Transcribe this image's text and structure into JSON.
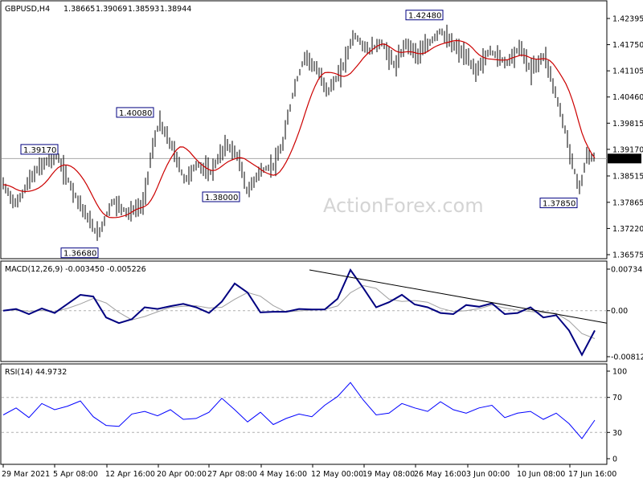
{
  "chart_data": [
    {
      "type": "candlestick",
      "panel": "price",
      "header": {
        "symbol": "GBPUSD,H4",
        "open": "1.38665",
        "high": "1.39069",
        "low": "1.38593",
        "close": "1.38944"
      },
      "ylim": [
        1.36575,
        1.42395
      ],
      "y_ticks": [
        "1.42395",
        "1.41750",
        "1.41105",
        "1.40460",
        "1.39815",
        "1.39170",
        "1.38515",
        "1.37865",
        "1.37220",
        "1.36575"
      ],
      "current_price": "1.38944",
      "annotations": [
        {
          "label": "1.39170",
          "value": 1.3917
        },
        {
          "label": "1.36680",
          "value": 1.3668
        },
        {
          "label": "1.40080",
          "value": 1.4008
        },
        {
          "label": "1.38000",
          "value": 1.38
        },
        {
          "label": "1.42480",
          "value": 1.4248
        },
        {
          "label": "1.37850",
          "value": 1.3785
        }
      ],
      "moving_average_color": "#cc0000",
      "watermark": "ActionForex.com"
    },
    {
      "type": "line",
      "panel": "macd",
      "title": "MACD(12,26,9) -0.003450 -0.005226",
      "y_ticks": [
        "0.007342",
        "0.00",
        "-0.008126"
      ],
      "ylim": [
        -0.008126,
        0.007342
      ],
      "macd_color": "#000080",
      "signal_color": "#a0a0a0",
      "trendline_color": "#000000",
      "macd_values": [
        0.0,
        0.0003,
        -0.0006,
        0.0004,
        -0.0004,
        0.0012,
        0.0028,
        0.0025,
        -0.0012,
        -0.0022,
        -0.0015,
        0.0006,
        0.0003,
        0.0008,
        0.0012,
        0.0006,
        -0.0004,
        0.0016,
        0.0048,
        0.0032,
        -0.0003,
        -0.0002,
        -0.0002,
        0.0003,
        0.0002,
        0.0002,
        0.0021,
        0.0072,
        0.004,
        0.0006,
        0.0015,
        0.0028,
        0.0011,
        0.0006,
        -0.0004,
        -0.0006,
        0.001,
        0.0007,
        0.0013,
        -0.0006,
        -0.0004,
        0.0006,
        -0.0012,
        -0.0008,
        -0.0035,
        -0.0078,
        -0.0035
      ]
    },
    {
      "type": "line",
      "panel": "rsi",
      "title": "RSI(14) 44.9732",
      "y_ticks": [
        "100",
        "70",
        "30",
        "0"
      ],
      "ylim": [
        0,
        100
      ],
      "levels": [
        70,
        30
      ],
      "line_color": "#0000ff",
      "values": [
        50,
        58,
        47,
        63,
        56,
        60,
        66,
        48,
        38,
        37,
        51,
        54,
        49,
        56,
        45,
        46,
        53,
        69,
        56,
        42,
        53,
        39,
        46,
        51,
        48,
        61,
        71,
        87,
        67,
        50,
        52,
        63,
        58,
        54,
        65,
        56,
        52,
        58,
        61,
        47,
        52,
        54,
        45,
        52,
        40,
        23,
        44
      ]
    }
  ],
  "x_axis": {
    "labels": [
      "29 Mar 2021",
      "5 Apr 08:00",
      "12 Apr 16:00",
      "20 Apr 00:00",
      "27 Apr 08:00",
      "4 May 16:00",
      "12 May 00:00",
      "19 May 08:00",
      "26 May 16:00",
      "3 Jun 00:00",
      "10 Jun 08:00",
      "17 Jun 16:00"
    ]
  }
}
